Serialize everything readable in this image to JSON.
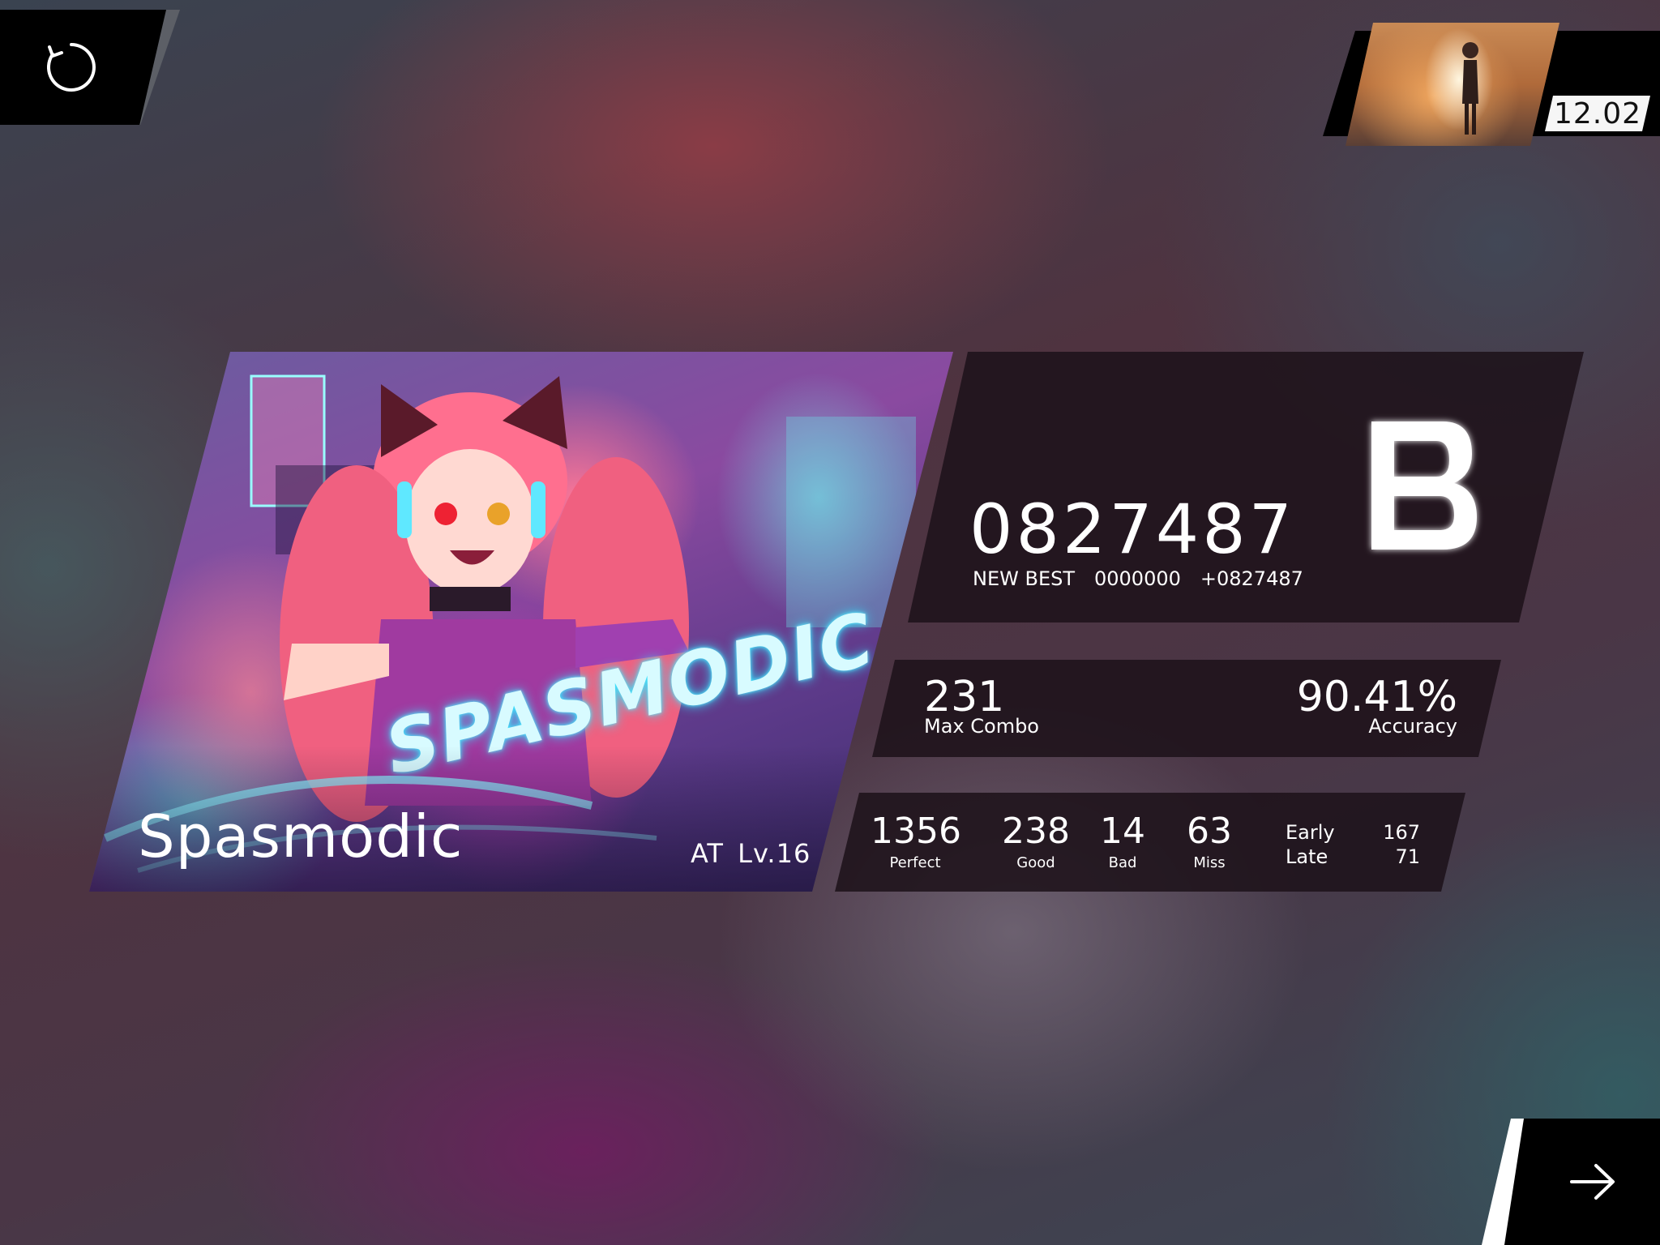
{
  "buttons": {
    "retry_icon": "retry-icon",
    "next_icon": "arrow-right-icon"
  },
  "player": {
    "ranking_score": "12.02"
  },
  "song": {
    "title": "Spasmodic",
    "difficulty": "AT",
    "level": "Lv.16",
    "level_text": "AT  Lv.16",
    "cover_logo": "SPASMODIC"
  },
  "score": {
    "value": "0827487",
    "new_best_label": "NEW BEST",
    "previous_best": "0000000",
    "delta": "+0827487",
    "rank": "B"
  },
  "stats": {
    "max_combo": "231",
    "max_combo_label": "Max Combo",
    "accuracy": "90.41%",
    "accuracy_label": "Accuracy"
  },
  "judgements": [
    {
      "count": "1356",
      "label": "Perfect"
    },
    {
      "count": "238",
      "label": "Good"
    },
    {
      "count": "14",
      "label": "Bad"
    },
    {
      "count": "63",
      "label": "Miss"
    }
  ],
  "timing": {
    "early_label": "Early",
    "late_label": "Late",
    "early": "167",
    "late": "71"
  },
  "colors": {
    "panel": "#1e121a",
    "button": "#000000",
    "text": "#ffffff"
  }
}
